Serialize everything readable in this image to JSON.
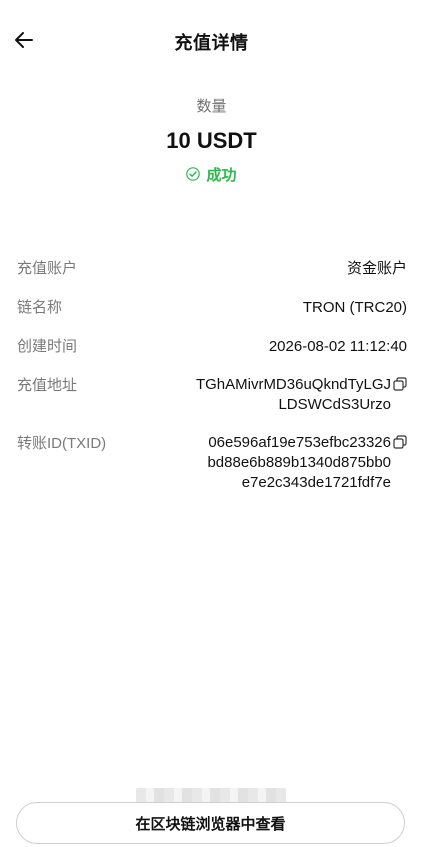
{
  "header": {
    "title": "充值详情",
    "back_icon": "arrow-left-icon"
  },
  "summary": {
    "amount_label": "数量",
    "amount": "10 USDT",
    "status": "成功",
    "status_icon": "check-circle-icon",
    "status_color": "#2db84d"
  },
  "details": {
    "account_label": "充值账户",
    "account_value": "资金账户",
    "chain_label": "链名称",
    "chain_value": "TRON (TRC20)",
    "time_label": "创建时间",
    "time_value": "2026-08-02 11:12:40",
    "address_label": "充值地址",
    "address_line1": "TGhAMivrMD36uQkndTyLGJ",
    "address_line2": "LDSWCdS3Urzo",
    "txid_label": "转账ID(TXID)",
    "txid_line1": "06e596af19e753efbc23326",
    "txid_line2": "bd88e6b889b1340d875bb0",
    "txid_line3": "e7e2c343de1721fdf7e",
    "copy_icon": "copy-icon"
  },
  "footer": {
    "explorer_button": "在区块链浏览器中查看"
  }
}
